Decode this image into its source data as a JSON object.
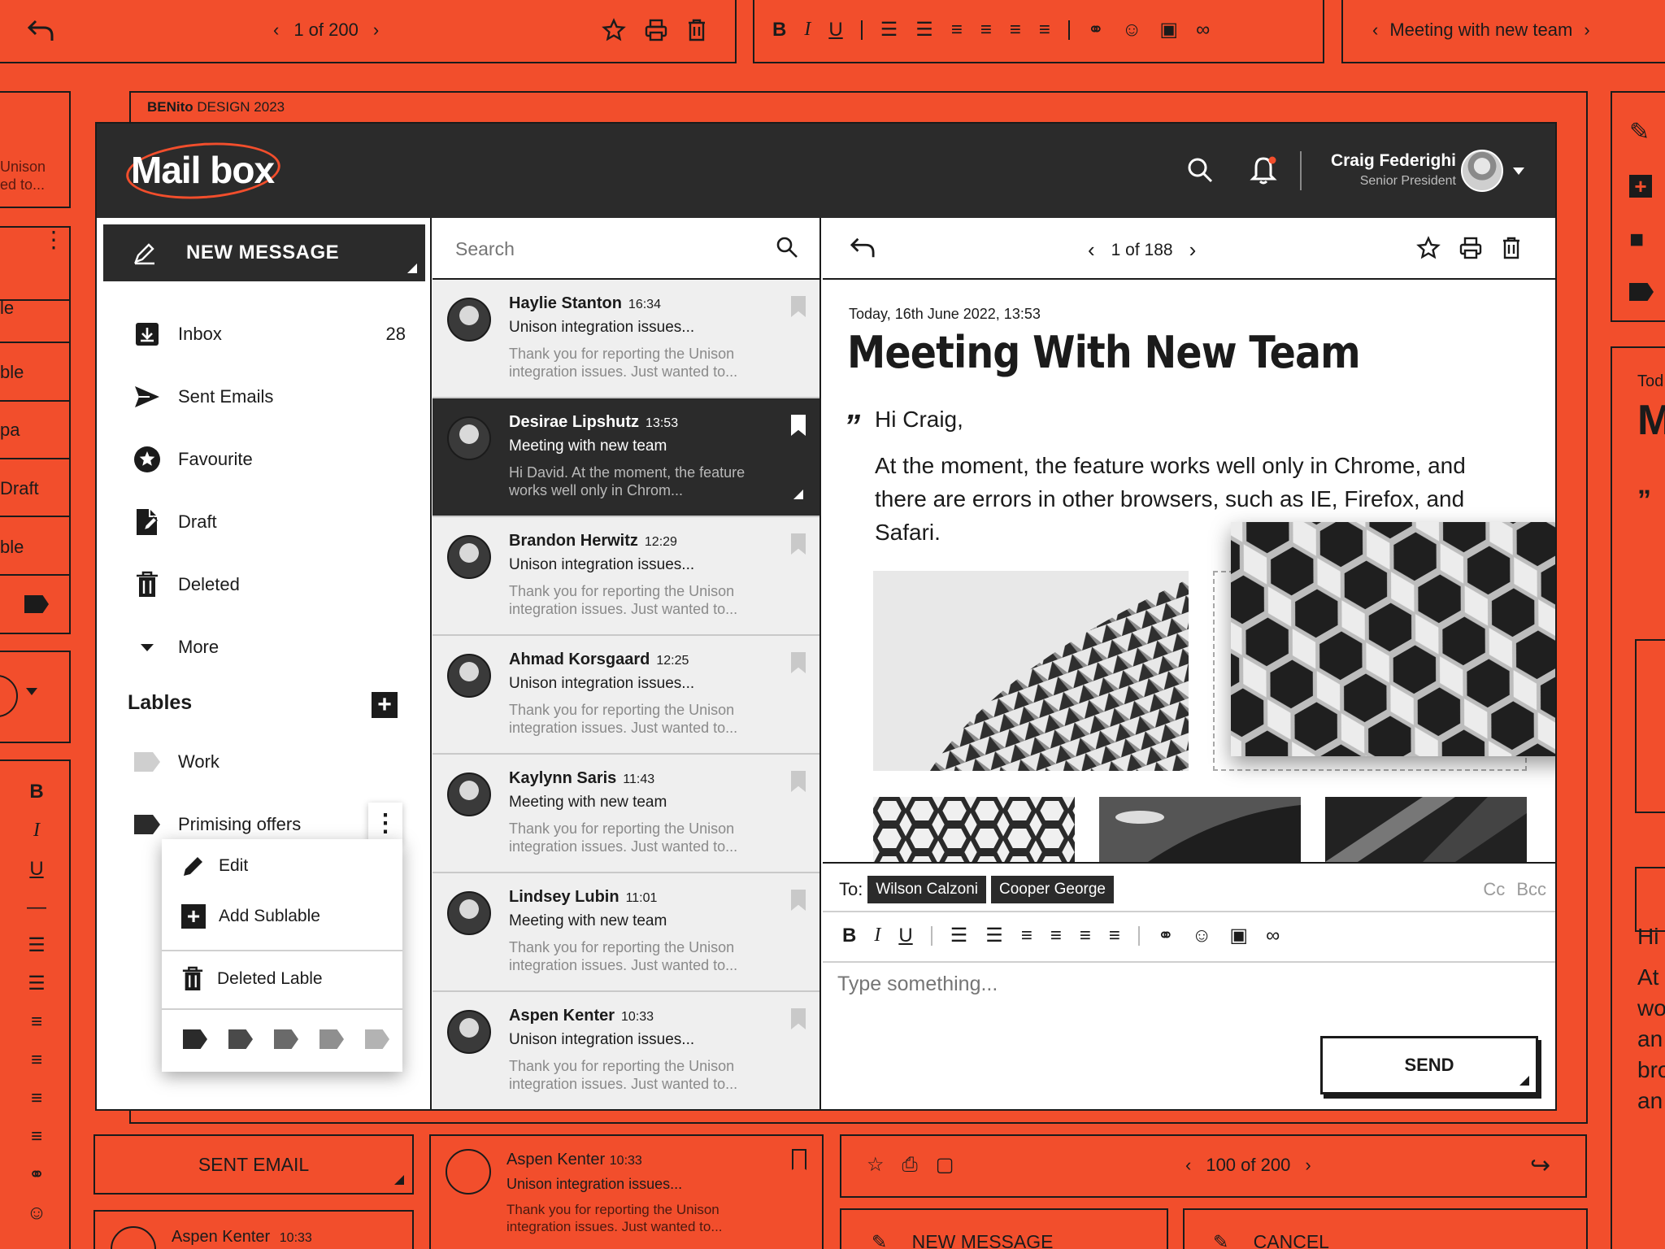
{
  "background": {
    "top_left_pager": "1 of 200",
    "top_right_subject": "Meeting with new team",
    "credit_brand": "BENito",
    "credit_rest": "DESIGN 2023",
    "left_partial_labels": [
      "Unison",
      "ed to...",
      "le",
      "ble",
      "pa",
      "Draft",
      "ble"
    ],
    "right_partial_texts": [
      "Tod",
      "M",
      "Hi",
      "At",
      "wo",
      "an",
      "bro",
      "an"
    ],
    "sent_email_button": "SENT EMAIL",
    "bottom_card": {
      "name": "Aspen Kenter",
      "time": "10:33",
      "subject": "Unison integration issues...",
      "snippet": "Thank you for reporting the Unison integration issues. Just wanted to..."
    },
    "bottom_card2": {
      "name": "Aspen Kenter",
      "time": "10:33"
    },
    "bottom_pager": "100 of 200",
    "bottom_new_message": "NEW MESSAGE",
    "bottom_cancel": "CANCEL"
  },
  "header": {
    "logo": "Mail box",
    "user_name": "Craig Federighi",
    "user_role": "Senior President"
  },
  "sidebar": {
    "new_message": "NEW MESSAGE",
    "items": [
      {
        "label": "Inbox",
        "count": "28",
        "icon": "inbox-icon"
      },
      {
        "label": "Sent Emails",
        "icon": "send-icon"
      },
      {
        "label": "Favourite",
        "icon": "star-icon"
      },
      {
        "label": "Draft",
        "icon": "draft-icon"
      },
      {
        "label": "Deleted",
        "icon": "trash-icon"
      },
      {
        "label": "More",
        "icon": "caret-down-icon"
      }
    ],
    "labels_heading": "Lables",
    "labels": [
      {
        "label": "Work",
        "color": "#cfcfcf"
      },
      {
        "label": "Primising offers",
        "color": "#2b2b2b"
      }
    ],
    "context_menu": {
      "edit": "Edit",
      "add_sublabel": "Add Sublable",
      "delete": "Deleted Lable",
      "swatches": [
        "#2b2b2b",
        "#4a4a4a",
        "#6a6a6a",
        "#8f8f8f",
        "#b3b3b3"
      ]
    }
  },
  "list": {
    "search_placeholder": "Search",
    "items": [
      {
        "name": "Haylie Stanton",
        "time": "16:34",
        "subject": "Unison integration issues...",
        "snippet": "Thank you for reporting the Unison integration issues. Just wanted to...",
        "selected": false
      },
      {
        "name": "Desirae Lipshutz",
        "time": "13:53",
        "subject": "Meeting with new team",
        "snippet": "Hi David. At the moment, the feature works well only in Chrom...",
        "selected": true
      },
      {
        "name": "Brandon Herwitz",
        "time": "12:29",
        "subject": "Unison integration issues...",
        "snippet": "Thank you for reporting the Unison integration issues. Just wanted to...",
        "selected": false
      },
      {
        "name": "Ahmad Korsgaard",
        "time": "12:25",
        "subject": "Unison integration issues...",
        "snippet": "Thank you for reporting the Unison integration issues. Just wanted to...",
        "selected": false
      },
      {
        "name": "Kaylynn Saris",
        "time": "11:43",
        "subject": "Meeting with new team",
        "snippet": "Thank you for reporting the Unison integration issues. Just wanted to...",
        "selected": false
      },
      {
        "name": "Lindsey Lubin",
        "time": "11:01",
        "subject": "Meeting with new team",
        "snippet": "Thank you for reporting the Unison integration issues. Just wanted to...",
        "selected": false
      },
      {
        "name": "Aspen Kenter",
        "time": "10:33",
        "subject": "Unison integration issues...",
        "snippet": "Thank you for reporting the Unison integration issues. Just wanted to...",
        "selected": false
      }
    ]
  },
  "reader": {
    "pager": "1 of 188",
    "date": "Today, 16th June 2022, 13:53",
    "title": "Meeting With New Team",
    "greeting": "Hi Craig,",
    "body": "At the moment, the feature works well only in Chrome, and there are errors in other browsers, such as IE, Firefox, and Safari."
  },
  "compose": {
    "to_label": "To:",
    "recipients": [
      "Wilson Calzoni",
      "Cooper George"
    ],
    "cc": "Cc",
    "bcc": "Bcc",
    "placeholder": "Type something...",
    "send": "SEND"
  },
  "colors": {
    "accent": "#f24e2c",
    "dark": "#2b2b2b",
    "light": "#efefef"
  }
}
